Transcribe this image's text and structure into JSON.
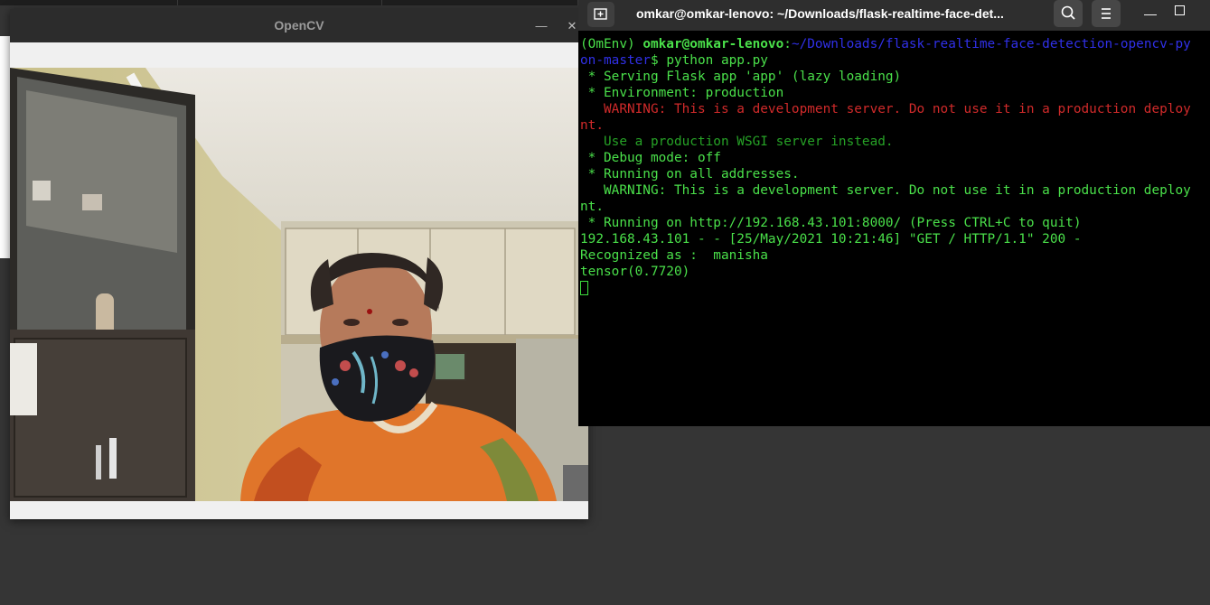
{
  "opencv_window": {
    "title": "OpenCV",
    "minimize_glyph": "—",
    "close_glyph": "✕"
  },
  "terminal": {
    "title": "omkar@omkar-lenovo: ~/Downloads/flask-realtime-face-det...",
    "minimize_glyph": "—",
    "prompt_env": "(OmEnv) ",
    "prompt_user": "omkar@omkar-lenovo",
    "prompt_colon": ":",
    "prompt_path_1": "~/Downloads/flask-realtime-face-detection-opencv-py",
    "prompt_path_2": "on-master",
    "prompt_symbol": "$ ",
    "command": "python app.py",
    "lines": {
      "serving": " * Serving Flask app 'app' (lazy loading)",
      "environment": " * Environment: production",
      "warning1_a": "   WARNING: This is a development server. Do not use it in a production deploy",
      "warning1_b": "nt.",
      "use_wsgi": "   Use a production WSGI server instead.",
      "debug": " * Debug mode: off",
      "running_all": " * Running on all addresses.",
      "warning2_a": "   WARNING: This is a development server. Do not use it in a production deploy",
      "warning2_b": "nt.",
      "running_on": " * Running on http://192.168.43.101:8000/ (Press CTRL+C to quit)",
      "get_log": "192.168.43.101 - - [25/May/2021 10:21:46] \"GET / HTTP/1.1\" 200 -",
      "recognized": "Recognized as :  manisha",
      "tensor": "tensor(0.7720)"
    }
  },
  "colors": {
    "terminal_green": "#4ae04a",
    "terminal_red": "#d02a2a",
    "terminal_blue": "#3030e8",
    "terminal_dark_green": "#26a226",
    "desktop_background": "#353535"
  }
}
